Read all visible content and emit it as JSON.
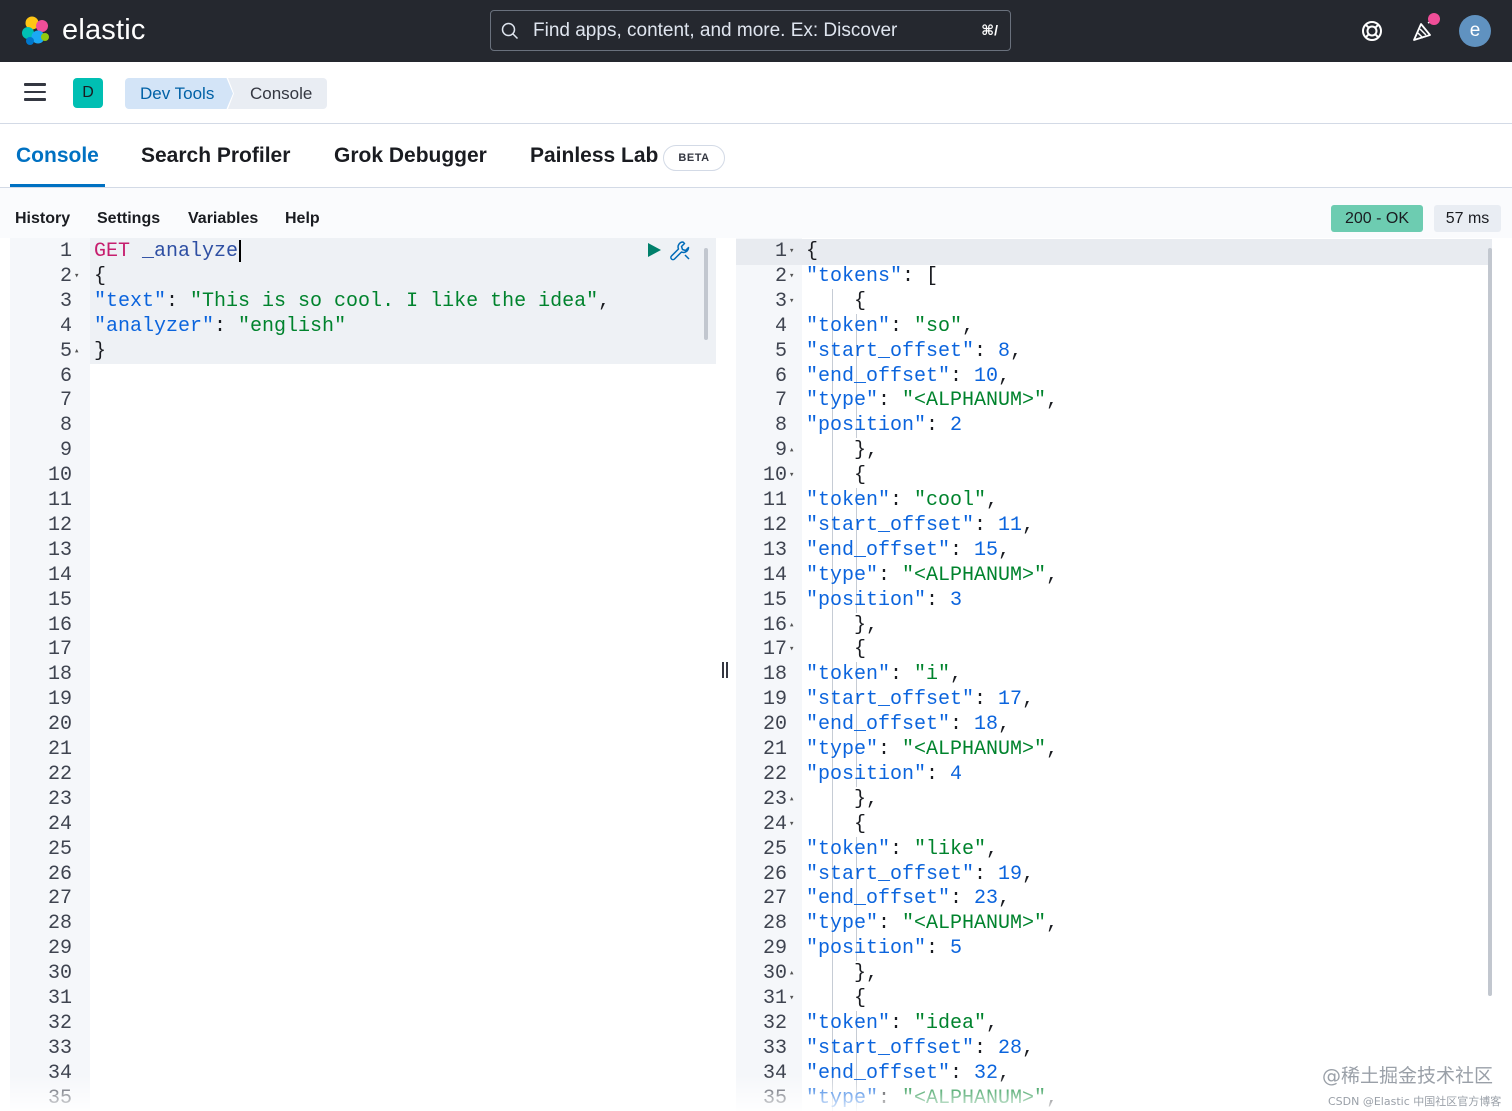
{
  "header": {
    "logo_text": "elastic",
    "search_placeholder": "Find apps, content, and more. Ex: Discover",
    "search_shortcut": "⌘/",
    "avatar_letter": "e"
  },
  "breadcrumb": {
    "space_letter": "D",
    "items": [
      "Dev Tools",
      "Console"
    ]
  },
  "tabs": [
    {
      "label": "Console",
      "active": true
    },
    {
      "label": "Search Profiler"
    },
    {
      "label": "Grok Debugger"
    },
    {
      "label": "Painless Lab"
    }
  ],
  "beta_label": "BETA",
  "toolbar": {
    "items": [
      "History",
      "Settings",
      "Variables",
      "Help"
    ]
  },
  "status": {
    "code": "200 - OK",
    "time": "57 ms"
  },
  "request_lines": [
    "GET _analyze",
    "{",
    "  \"text\": \"This is so cool. I like the idea\",",
    "  \"analyzer\": \"english\"",
    "}"
  ],
  "request_line_count": 35,
  "response_lines": [
    "{",
    "  \"tokens\": [",
    "    {",
    "      \"token\": \"so\",",
    "      \"start_offset\": 8,",
    "      \"end_offset\": 10,",
    "      \"type\": \"<ALPHANUM>\",",
    "      \"position\": 2",
    "    },",
    "    {",
    "      \"token\": \"cool\",",
    "      \"start_offset\": 11,",
    "      \"end_offset\": 15,",
    "      \"type\": \"<ALPHANUM>\",",
    "      \"position\": 3",
    "    },",
    "    {",
    "      \"token\": \"i\",",
    "      \"start_offset\": 17,",
    "      \"end_offset\": 18,",
    "      \"type\": \"<ALPHANUM>\",",
    "      \"position\": 4",
    "    },",
    "    {",
    "      \"token\": \"like\",",
    "      \"start_offset\": 19,",
    "      \"end_offset\": 23,",
    "      \"type\": \"<ALPHANUM>\",",
    "      \"position\": 5",
    "    },",
    "    {",
    "      \"token\": \"idea\",",
    "      \"start_offset\": 28,",
    "      \"end_offset\": 32,",
    "      \"type\": \"<ALPHANUM>\","
  ],
  "watermark": {
    "line1": "@稀土掘金技术社区",
    "line2": "CSDN @Elastic 中国社区官方博客"
  },
  "colors": {
    "accent": "#0071c2",
    "header_bg": "#25282f",
    "status_ok": "#6dccb1",
    "space_badge": "#00bfb3"
  }
}
